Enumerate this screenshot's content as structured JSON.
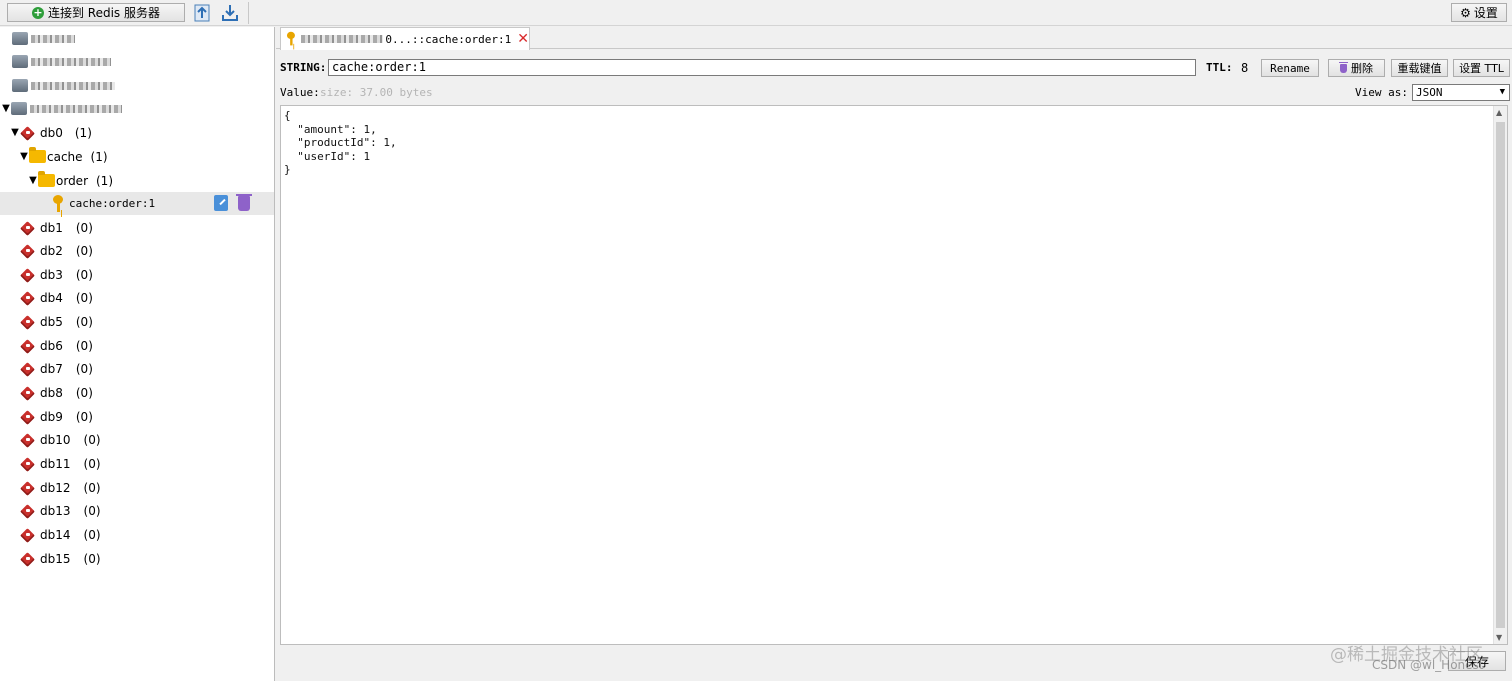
{
  "toolbar": {
    "connect_label": "连接到 Redis 服务器",
    "import_icon": "import-icon",
    "export_icon": "export-icon",
    "settings_label": "设置"
  },
  "tree": {
    "db0": {
      "label": "db0",
      "count": "(1)"
    },
    "folder_cache": {
      "label": "cache",
      "count": "(1)"
    },
    "folder_order": {
      "label": "order",
      "count": "(1)"
    },
    "key": {
      "label": "cache:order:1"
    },
    "dbs": [
      {
        "label": "db1",
        "count": "(0)"
      },
      {
        "label": "db2",
        "count": "(0)"
      },
      {
        "label": "db3",
        "count": "(0)"
      },
      {
        "label": "db4",
        "count": "(0)"
      },
      {
        "label": "db5",
        "count": "(0)"
      },
      {
        "label": "db6",
        "count": "(0)"
      },
      {
        "label": "db7",
        "count": "(0)"
      },
      {
        "label": "db8",
        "count": "(0)"
      },
      {
        "label": "db9",
        "count": "(0)"
      },
      {
        "label": "db10",
        "count": "(0)"
      },
      {
        "label": "db11",
        "count": "(0)"
      },
      {
        "label": "db12",
        "count": "(0)"
      },
      {
        "label": "db13",
        "count": "(0)"
      },
      {
        "label": "db14",
        "count": "(0)"
      },
      {
        "label": "db15",
        "count": "(0)"
      }
    ]
  },
  "tab": {
    "label_suffix": "0...::cache:order:1"
  },
  "key_panel": {
    "type_label": "STRING:",
    "key_value": "cache:order:1",
    "ttl_label": "TTL:",
    "ttl_value": "8",
    "rename_label": "Rename",
    "delete_label": "删除",
    "reload_label": "重载键值",
    "set_ttl_label": "设置 TTL",
    "value_label": "Value:",
    "size_text": "size: 37.00 bytes",
    "view_as_label": "View as:",
    "view_as_value": "JSON",
    "editor_text": "{\n  \"amount\": 1,\n  \"productId\": 1,\n  \"userId\": 1\n}",
    "save_label": "保存"
  },
  "watermark": {
    "line1": "@稀土掘金技术社区",
    "line2": "CSDN @wl_Honest"
  },
  "colors": {
    "db_icon": "#c9302c",
    "folder": "#f5b800",
    "key": "#e8a500",
    "trash": "#8e62c9",
    "close": "#d9292b"
  }
}
